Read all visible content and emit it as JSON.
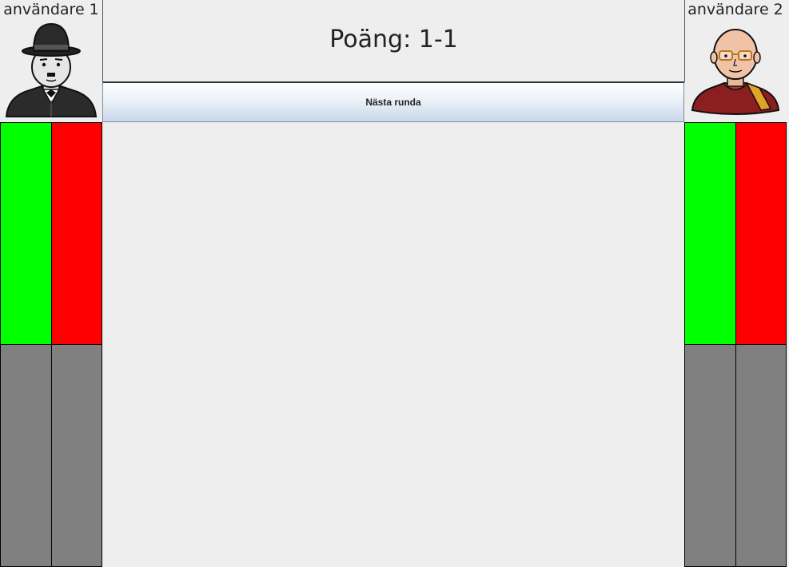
{
  "player1": {
    "name": "användare 1",
    "avatar_icon": "man-bowler-hat-avatar-icon"
  },
  "player2": {
    "name": "användare 2",
    "avatar_icon": "bald-man-glasses-avatar-icon"
  },
  "score": {
    "text": "Poäng: 1-1"
  },
  "next_round_button": {
    "label": "Nästa runda"
  },
  "colors": {
    "background": "#eeeeee",
    "correct": "#00ff00",
    "wrong": "#ff0000",
    "unanswered": "#808080"
  }
}
